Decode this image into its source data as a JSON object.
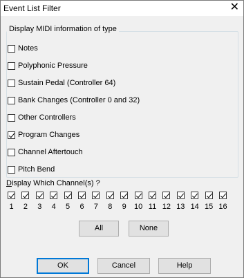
{
  "window": {
    "title": "Event List Filter",
    "close_glyph": "✕"
  },
  "group": {
    "legend": "Display MIDI information  of type",
    "items": [
      {
        "label": "Notes",
        "checked": false
      },
      {
        "label": "Polyphonic Pressure",
        "checked": false
      },
      {
        "label": "Sustain Pedal (Controller 64)",
        "checked": false
      },
      {
        "label": "Bank Changes (Controller 0 and 32)",
        "checked": false
      },
      {
        "label": "Other Controllers",
        "checked": false
      },
      {
        "label": "Program Changes",
        "checked": true
      },
      {
        "label": "Channel Aftertouch",
        "checked": false
      },
      {
        "label": "Pitch Bend",
        "checked": false
      }
    ]
  },
  "channels": {
    "title": "Display Which Channel(s) ?",
    "items": [
      {
        "num": "1",
        "checked": true
      },
      {
        "num": "2",
        "checked": true
      },
      {
        "num": "3",
        "checked": true
      },
      {
        "num": "4",
        "checked": true
      },
      {
        "num": "5",
        "checked": true
      },
      {
        "num": "6",
        "checked": true
      },
      {
        "num": "7",
        "checked": true
      },
      {
        "num": "8",
        "checked": true
      },
      {
        "num": "9",
        "checked": true
      },
      {
        "num": "10",
        "checked": true
      },
      {
        "num": "11",
        "checked": true
      },
      {
        "num": "12",
        "checked": true
      },
      {
        "num": "13",
        "checked": true
      },
      {
        "num": "14",
        "checked": true
      },
      {
        "num": "15",
        "checked": true
      },
      {
        "num": "16",
        "checked": true
      }
    ]
  },
  "buttons": {
    "all": "All",
    "none": "None",
    "ok": "OK",
    "cancel": "Cancel",
    "help": "Help"
  }
}
